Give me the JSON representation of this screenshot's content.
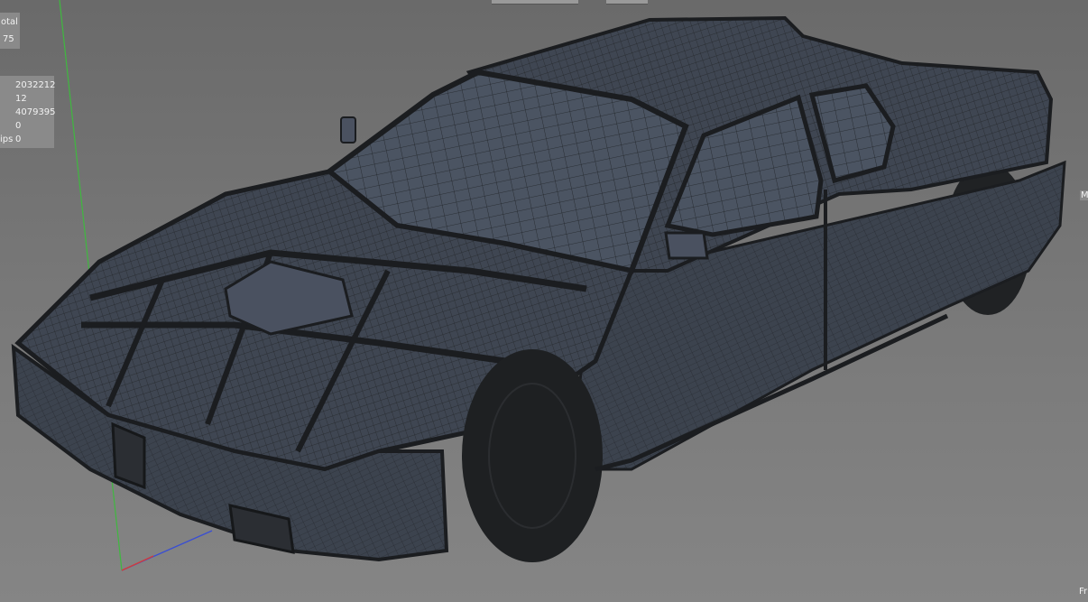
{
  "stats": {
    "header_fragment": "otal",
    "header_value_fragment": "75",
    "values": [
      "2032212",
      "12",
      "4079395",
      "0"
    ],
    "last_row_label_fragment": "ips",
    "last_row_value": "0"
  },
  "right_edge": {
    "top_fragment": "M",
    "bottom_fragment": "Fr"
  },
  "colors": {
    "mesh_body": "#3e4550",
    "mesh_edge": "#1b1d20",
    "axis_y": "#3fb83f",
    "axis_x": "#d23a3a",
    "axis_z": "#3a4fd2"
  },
  "icons": {
    "axis_gizmo": "axis-gizmo-icon"
  }
}
